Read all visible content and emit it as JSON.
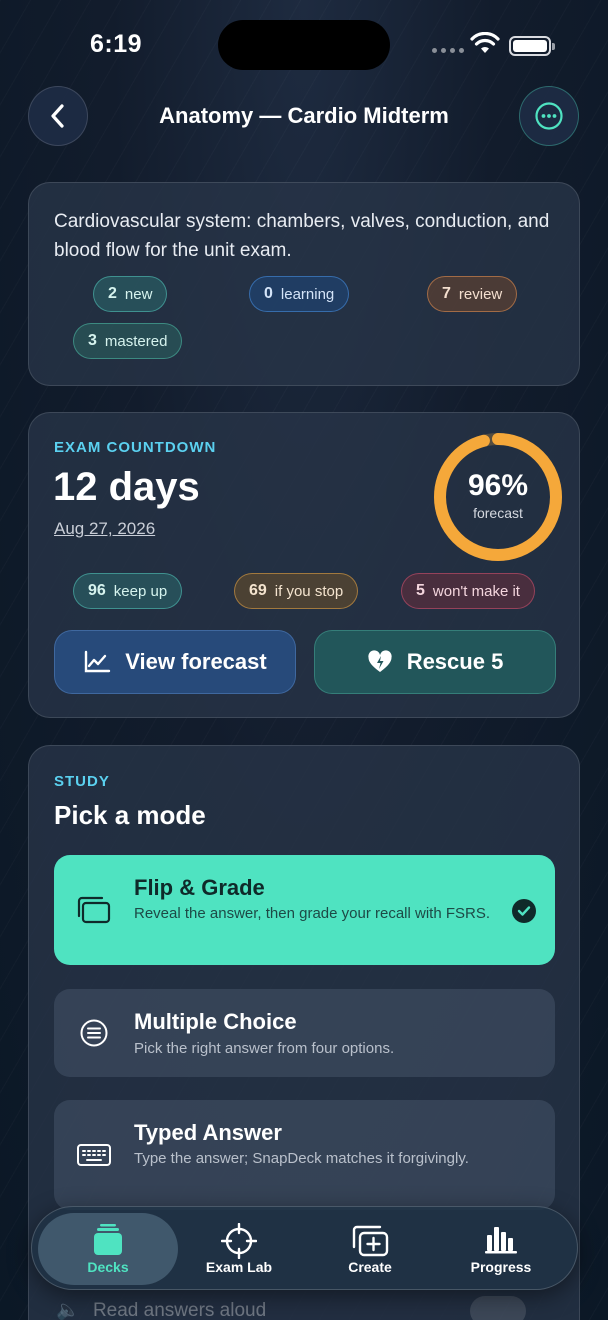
{
  "status_bar": {
    "time": "6:19"
  },
  "header": {
    "title": "Anatomy — Cardio Midterm"
  },
  "deck": {
    "description": "Cardiovascular system: chambers, valves, conduction, and blood flow for the unit exam.",
    "counts": [
      {
        "n": "2",
        "label": "new"
      },
      {
        "n": "0",
        "label": "learning"
      },
      {
        "n": "7",
        "label": "review"
      },
      {
        "n": "3",
        "label": "mastered"
      }
    ]
  },
  "exam": {
    "kicker": "EXAM COUNTDOWN",
    "days": "12 days",
    "date": "Aug 27, 2026",
    "forecast_pct": "96%",
    "forecast_label": "forecast",
    "forecast_fraction": 0.96,
    "scenarios": [
      {
        "n": "96",
        "label": "keep up"
      },
      {
        "n": "69",
        "label": "if you stop"
      },
      {
        "n": "5",
        "label": "won't make it"
      }
    ],
    "view_forecast_label": "View forecast",
    "rescue_label": "Rescue 5"
  },
  "study": {
    "kicker": "STUDY",
    "title": "Pick a mode",
    "modes": [
      {
        "title": "Flip & Grade",
        "desc": "Reveal the answer, then grade your recall with FSRS.",
        "icon": "cards-icon",
        "selected": true
      },
      {
        "title": "Multiple Choice",
        "desc": "Pick the right answer from four options.",
        "icon": "list-icon",
        "selected": false
      },
      {
        "title": "Typed Answer",
        "desc": "Type the answer; SnapDeck matches it forgivingly.",
        "icon": "keyboard-icon",
        "selected": false
      }
    ],
    "hidden_rows": [
      {
        "label": "Read answers aloud"
      }
    ]
  },
  "tabbar": {
    "tabs": [
      {
        "label": "Decks",
        "icon": "decks-icon",
        "active": true
      },
      {
        "label": "Exam Lab",
        "icon": "crosshair-icon",
        "active": false
      },
      {
        "label": "Create",
        "icon": "create-icon",
        "active": false
      },
      {
        "label": "Progress",
        "icon": "bar-chart-icon",
        "active": false
      }
    ]
  },
  "colors": {
    "accent": "#4fe3c1",
    "kicker": "#5bd1f0",
    "ring": "#f5a83a"
  }
}
